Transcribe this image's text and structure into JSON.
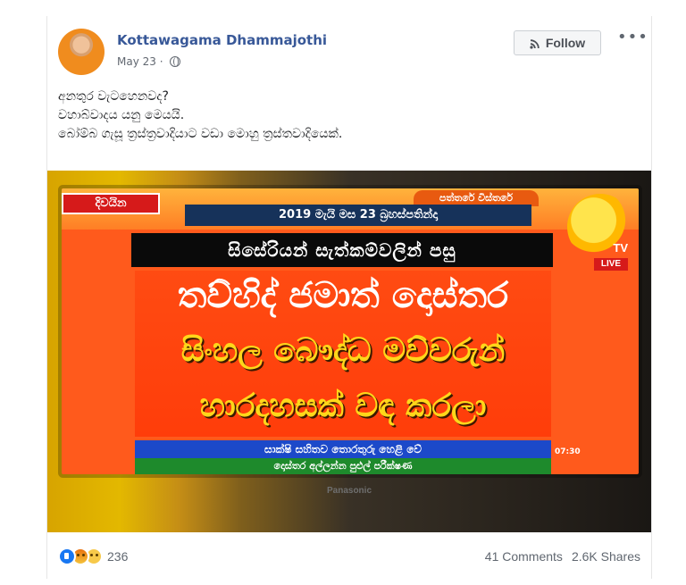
{
  "post": {
    "author": "Kottawagama Dhammajothi",
    "date": "May 23",
    "separator": "·",
    "follow_label": "Follow",
    "more_label": "•••",
    "text_lines": [
      "අනතුර වැටහෙනවද?",
      "වහාබ්වාදය යනු මෙයයි.",
      "බෝම්බ ගැසූ ත්‍රස්ත්‍රවාදියාට වඩා මොහු ත්‍රස්තවාදියෙක්."
    ]
  },
  "image": {
    "tag_left": "දිවයින",
    "corner_label": "පත්තරේ විස්තරේ",
    "date_strip": "2019 මැයි මස 23 බ්‍රහස්පතින්දා",
    "headline_top": "සිසේරියන් සැත්කම්වලින් පසු",
    "headline_line1": "තව්හිද් ජමාත් දොස්තර",
    "headline_line2": "සිංහල බෞද්ධ මව්වරුන්",
    "headline_line3": "හාරදහසක් වඳ කරලා",
    "ticker_blue": "සාක්ෂි සහිතව තොරතුරු හෙළි වේ",
    "ticker_green": "දොස්තර අල්ලන්න පුළුල් පරීක්ෂණ",
    "time_text": "07:30",
    "logo_tv": "TV",
    "logo_live": "LIVE",
    "tv_brand": "Panasonic"
  },
  "stats": {
    "reaction_count": "236",
    "comments": "41 Comments",
    "shares": "2.6K Shares"
  },
  "icons": {
    "globe": "globe-icon",
    "rss": "rss-icon",
    "more": "more-icon",
    "like": "like-reaction-icon",
    "angry": "angry-reaction-icon",
    "sad": "sad-reaction-icon"
  },
  "colors": {
    "author_link": "#385898",
    "meta_gray": "#616770",
    "follow_bg": "#f5f6f7",
    "like_blue": "#1877f2"
  }
}
